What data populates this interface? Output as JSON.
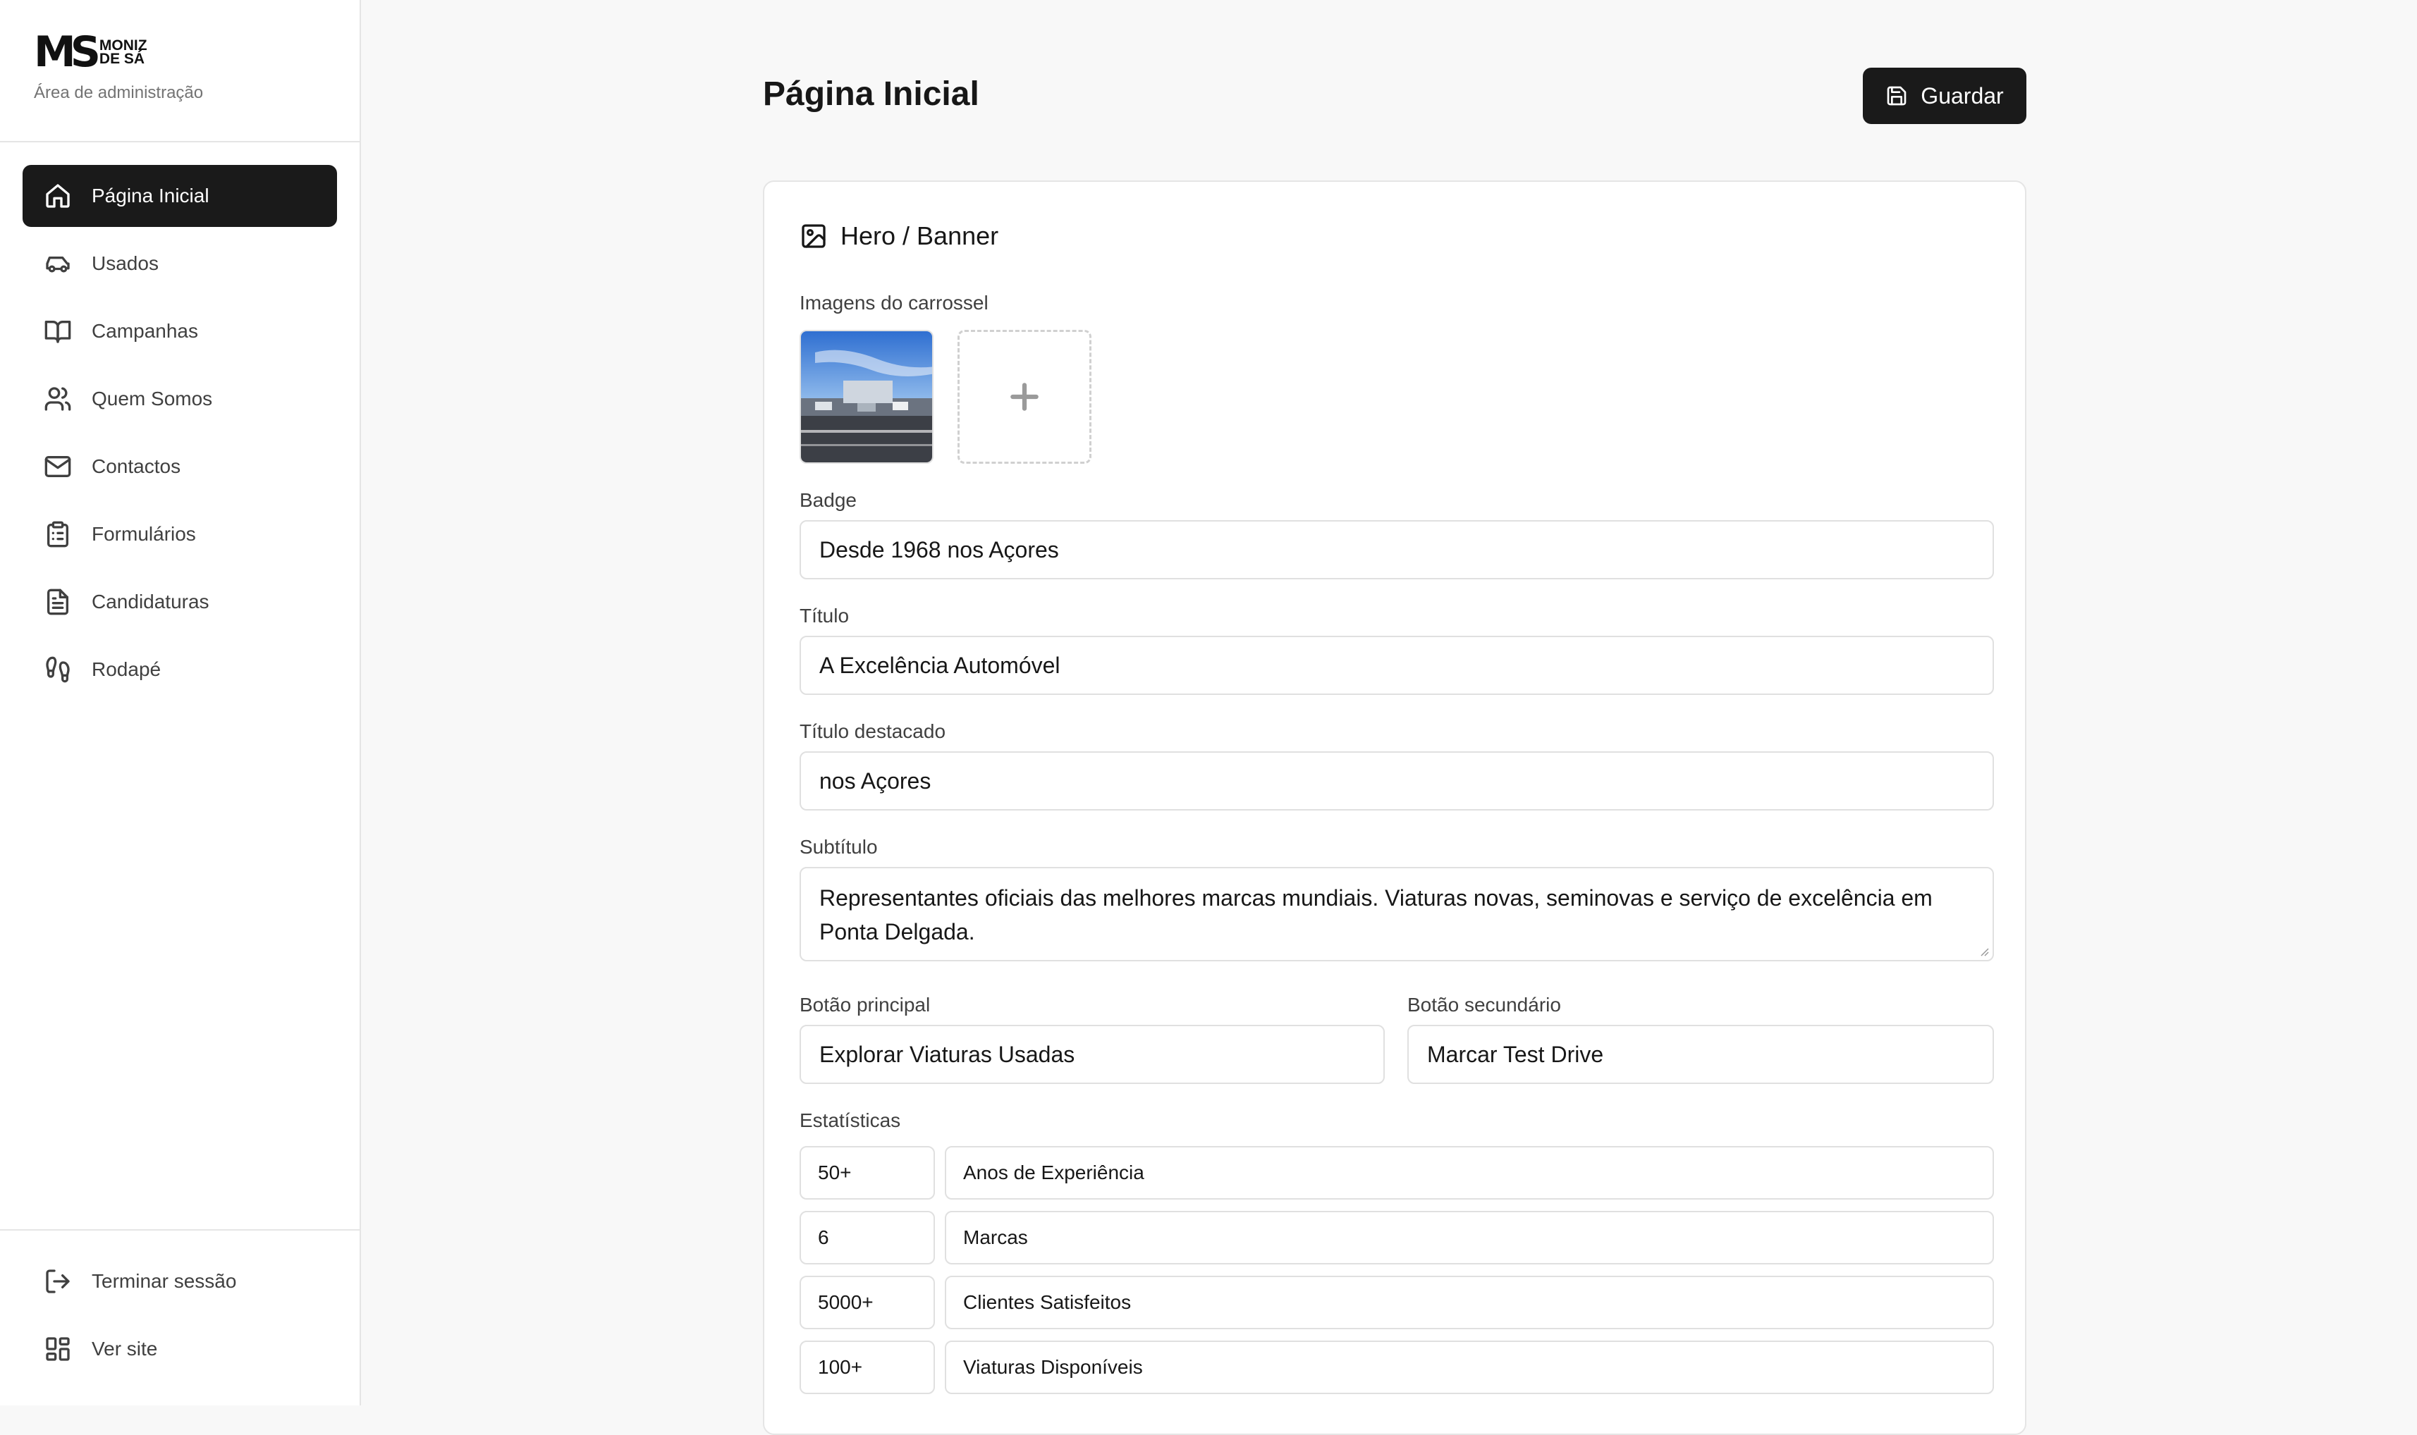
{
  "sidebar": {
    "brand": {
      "mark": "MS",
      "word1": "MONIZ",
      "word2": "DE SÁ",
      "subtitle": "Área de administração"
    },
    "items": [
      {
        "label": "Página Inicial",
        "icon": "home-icon",
        "active": true
      },
      {
        "label": "Usados",
        "icon": "car-icon",
        "active": false
      },
      {
        "label": "Campanhas",
        "icon": "book-open-icon",
        "active": false
      },
      {
        "label": "Quem Somos",
        "icon": "users-icon",
        "active": false
      },
      {
        "label": "Contactos",
        "icon": "mail-icon",
        "active": false
      },
      {
        "label": "Formulários",
        "icon": "clipboard-list-icon",
        "active": false
      },
      {
        "label": "Candidaturas",
        "icon": "file-text-icon",
        "active": false
      },
      {
        "label": "Rodapé",
        "icon": "footprints-icon",
        "active": false
      }
    ],
    "bottom": [
      {
        "label": "Terminar sessão",
        "icon": "log-out-icon"
      },
      {
        "label": "Ver site",
        "icon": "layout-dashboard-icon"
      }
    ]
  },
  "header": {
    "title": "Página Inicial",
    "save_label": "Guardar",
    "save_icon": "save-icon"
  },
  "hero": {
    "title": "Hero / Banner",
    "title_icon": "image-icon",
    "carousel_label": "Imagens do carrossel",
    "badge_label": "Badge",
    "badge_value": "Desde 1968 nos Açores",
    "title_label": "Título",
    "title_value": "A Excelência Automóvel",
    "highlight_label": "Título destacado",
    "highlight_value": "nos Açores",
    "subtitle_label": "Subtítulo",
    "subtitle_value": "Representantes oficiais das melhores marcas mundiais. Viaturas novas, seminovas e serviço de excelência em Ponta Delgada.",
    "primary_label": "Botão principal",
    "primary_value": "Explorar Viaturas Usadas",
    "secondary_label": "Botão secundário",
    "secondary_value": "Marcar Test Drive",
    "stats_label": "Estatísticas",
    "stats": [
      {
        "value": "50+",
        "label": "Anos de Experiência"
      },
      {
        "value": "6",
        "label": "Marcas"
      },
      {
        "value": "5000+",
        "label": "Clientes Satisfeitos"
      },
      {
        "value": "100+",
        "label": "Viaturas Disponíveis"
      }
    ]
  },
  "colors": {
    "accent": "#1a1a1a",
    "background": "#f8f8f8",
    "border": "#e0e0e0"
  }
}
